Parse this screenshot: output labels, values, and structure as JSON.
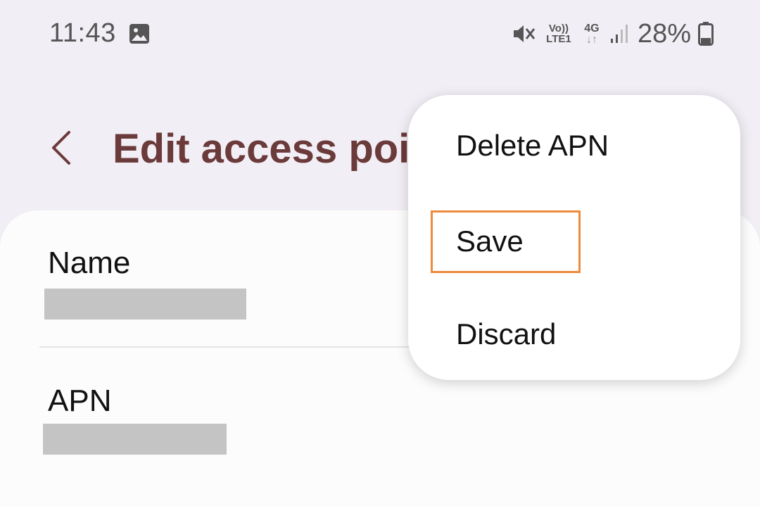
{
  "status_bar": {
    "time": "11:43",
    "volte_top": "Vo))",
    "volte_bottom": "LTE1",
    "network": "4G",
    "network_arrows": "↓↑",
    "battery": "28%"
  },
  "header": {
    "title": "Edit access point"
  },
  "settings": [
    {
      "label": "Name"
    },
    {
      "label": "APN"
    }
  ],
  "menu": {
    "items": [
      {
        "label": "Delete APN"
      },
      {
        "label": "Save"
      },
      {
        "label": "Discard"
      }
    ],
    "highlight_color": "#ee8a3a"
  },
  "colors": {
    "background": "#f2eef5",
    "title": "#6b3a3a",
    "card": "#fcfcfc"
  }
}
